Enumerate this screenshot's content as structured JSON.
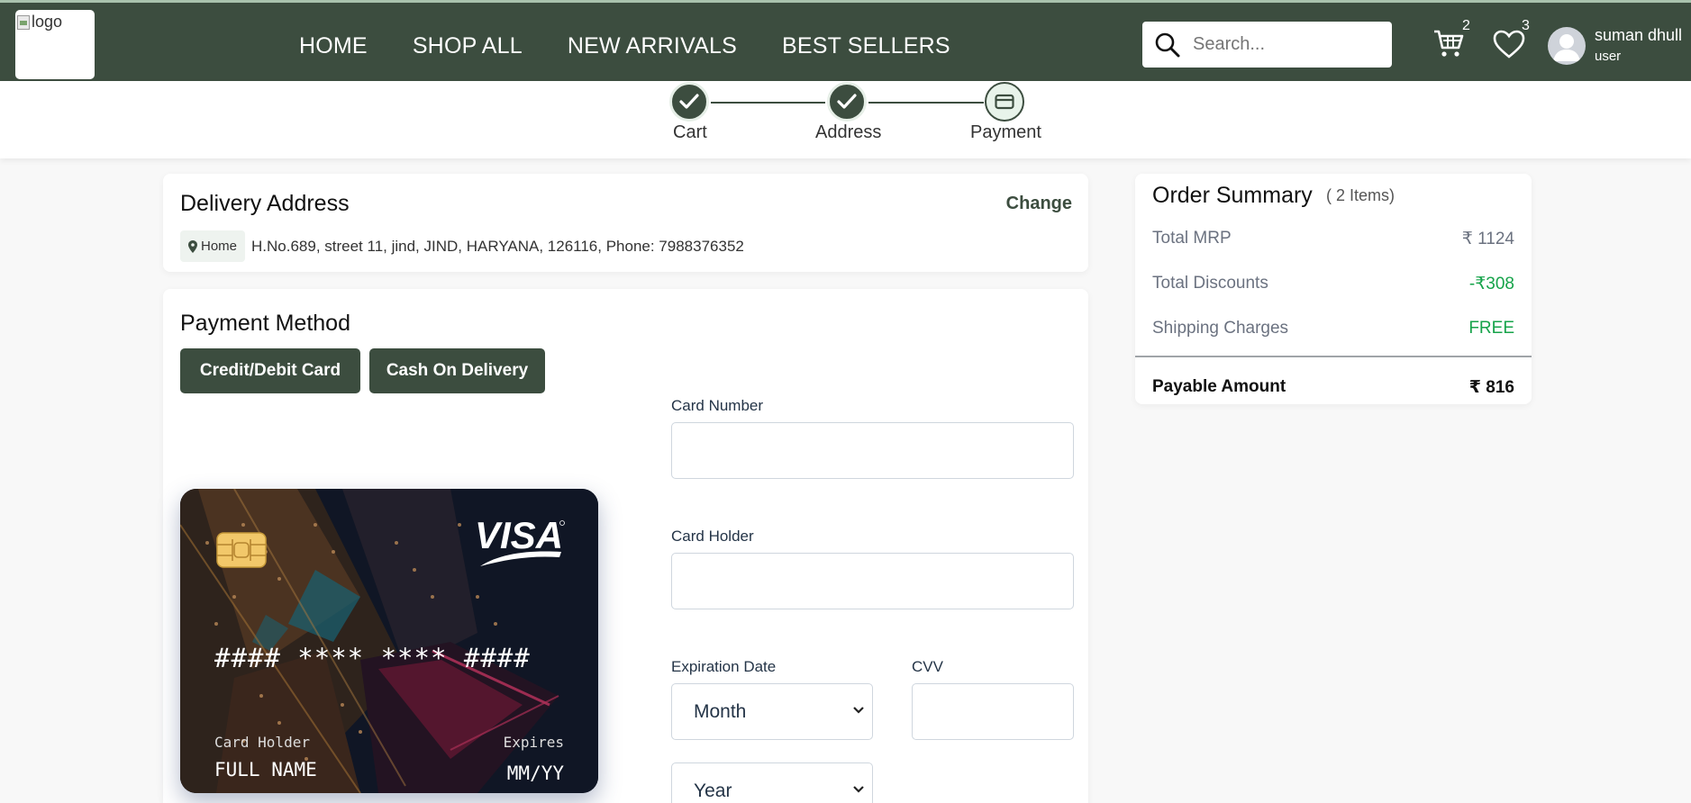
{
  "header": {
    "logo_alt": "logo",
    "nav": [
      "HOME",
      "SHOP ALL",
      "NEW ARRIVALS",
      "BEST SELLERS"
    ],
    "search_placeholder": "Search...",
    "cart_count": "2",
    "wishlist_count": "3",
    "user_name": "suman dhull",
    "user_role": "user",
    "bg_color": "#3c4d3f"
  },
  "stepper": {
    "steps": [
      {
        "label": "Cart",
        "state": "done"
      },
      {
        "label": "Address",
        "state": "done"
      },
      {
        "label": "Payment",
        "state": "current"
      }
    ]
  },
  "delivery": {
    "title": "Delivery Address",
    "change_label": "Change",
    "tag": "Home",
    "address": "H.No.689, street 11, jind, JIND, HARYANA, 126116, Phone: 7988376352"
  },
  "payment": {
    "title": "Payment Method",
    "methods": [
      "Credit/Debit Card",
      "Cash On Delivery"
    ],
    "card_preview": {
      "brand": "VISA",
      "number": "#### **** **** ####",
      "holder_label": "Card Holder",
      "holder_value": "FULL NAME",
      "expires_label": "Expires",
      "expires_value": "MM/YY"
    },
    "form": {
      "card_number_label": "Card Number",
      "card_holder_label": "Card Holder",
      "expiration_label": "Expiration Date",
      "month_value": "Month",
      "year_value": "Year",
      "cvv_label": "CVV"
    }
  },
  "summary": {
    "title": "Order Summary",
    "items_count": "( 2 Items)",
    "rows": [
      {
        "label": "Total MRP",
        "value": "₹ 1124",
        "color": "#6b7280"
      },
      {
        "label": "Total Discounts",
        "value": "-₹308",
        "color": "#16a34a"
      },
      {
        "label": "Shipping Charges",
        "value": "FREE",
        "color": "#16a34a"
      }
    ],
    "payable_label": "Payable Amount",
    "payable_value": "₹ 816"
  }
}
